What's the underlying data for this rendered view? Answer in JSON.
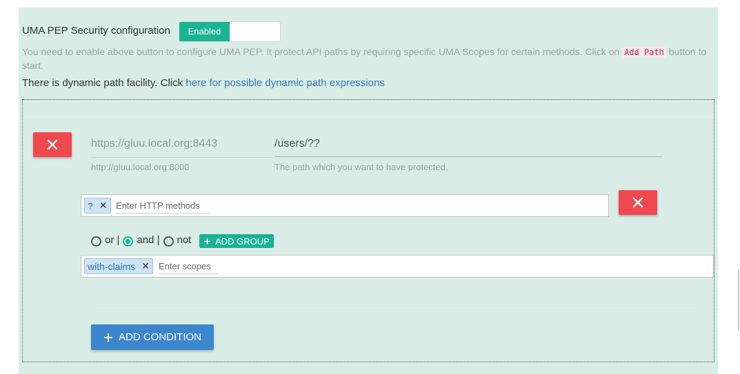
{
  "header": {
    "title": "UMA PEP Security configuration",
    "toggle_label": "Enabled"
  },
  "help": {
    "text_part1": "You need to enable above button to configure UMA PEP. It protect API paths by requiring specific UMA Scopes for certain methods. Click on ",
    "code": "Add Path",
    "text_part2": " button to start."
  },
  "dynamic": {
    "prefix": "There is dynamic path facility. Click ",
    "link": "here for possible dynamic path expressions"
  },
  "path_entry": {
    "base_url": "https://gluu.local.org:8443",
    "base_hint": "http://gluu.local.org:8000",
    "path_value": "/users/??",
    "path_hint": "The path which you want to have protected."
  },
  "methods": {
    "tags": [
      "?"
    ],
    "placeholder": "Enter HTTP methods"
  },
  "condition": {
    "options": [
      "or |",
      "and |",
      "not"
    ],
    "selected": "and |",
    "add_group_label": "ADD GROUP",
    "scope_tags": [
      "with-claims"
    ],
    "scopes_placeholder": "Enter scopes"
  },
  "add_condition_label": "ADD CONDITION",
  "colors": {
    "panel_bg": "#d9ede6",
    "accent_green": "#1ab394",
    "danger_red": "#f0484f",
    "primary_blue": "#3b86cc"
  }
}
